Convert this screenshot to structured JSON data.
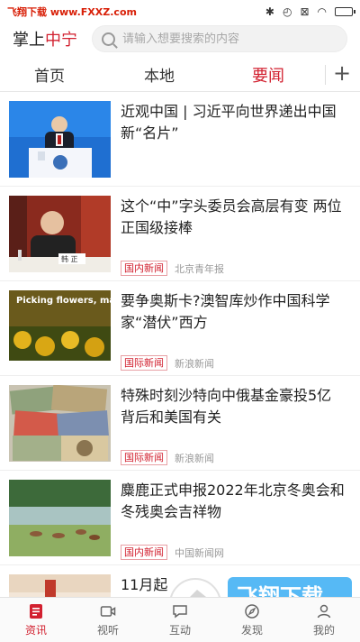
{
  "status": {
    "watermark": "飞翔下载 www.FXXZ.com"
  },
  "header": {
    "brand_prefix": "掌上",
    "brand_city": "中宁",
    "search_placeholder": "请输入想要搜索的内容"
  },
  "tabs": [
    {
      "label": "首页",
      "active": false
    },
    {
      "label": "本地",
      "active": false
    },
    {
      "label": "要闻",
      "active": true
    }
  ],
  "tab_add_label": "+",
  "feed": [
    {
      "title": "近观中国 | 习近平向世界递出中国新“名片”",
      "tag": "",
      "source": ""
    },
    {
      "title": "这个“中”字头委员会高层有变 两位正国级接棒",
      "tag": "国内新闻",
      "source": "北京青年报"
    },
    {
      "title": "要争奥斯卡?澳智库炒作中国科学家“潜伏”西方",
      "tag": "国际新闻",
      "source": "新浪新闻"
    },
    {
      "title": "特殊时刻沙特向中俄基金豪投5亿 背后和美国有关",
      "tag": "国际新闻",
      "source": "新浪新闻"
    },
    {
      "title": "麋鹿正式申报2022年北京冬奥会和冬残奥会吉祥物",
      "tag": "国内新闻",
      "source": "中国新闻网"
    },
    {
      "title": "11月起",
      "tag": "",
      "source": ""
    }
  ],
  "thumb_texts": {
    "pinyin_slide": "Picking flowers, making honey.",
    "nameplate": "韩 正"
  },
  "bottom_nav": [
    {
      "label": "资讯",
      "icon": "news-icon",
      "active": true
    },
    {
      "label": "视听",
      "icon": "video-icon",
      "active": false
    },
    {
      "label": "互动",
      "icon": "chat-icon",
      "active": false
    },
    {
      "label": "发现",
      "icon": "discover-icon",
      "active": false
    },
    {
      "label": "我的",
      "icon": "profile-icon",
      "active": false
    }
  ],
  "overlay_logo": {
    "cn": "飞翔下载",
    "url": "www.fxxz.com"
  },
  "colors": {
    "accent": "#d2202f",
    "tag_border": "#e8a0a5",
    "muted": "#999999"
  }
}
